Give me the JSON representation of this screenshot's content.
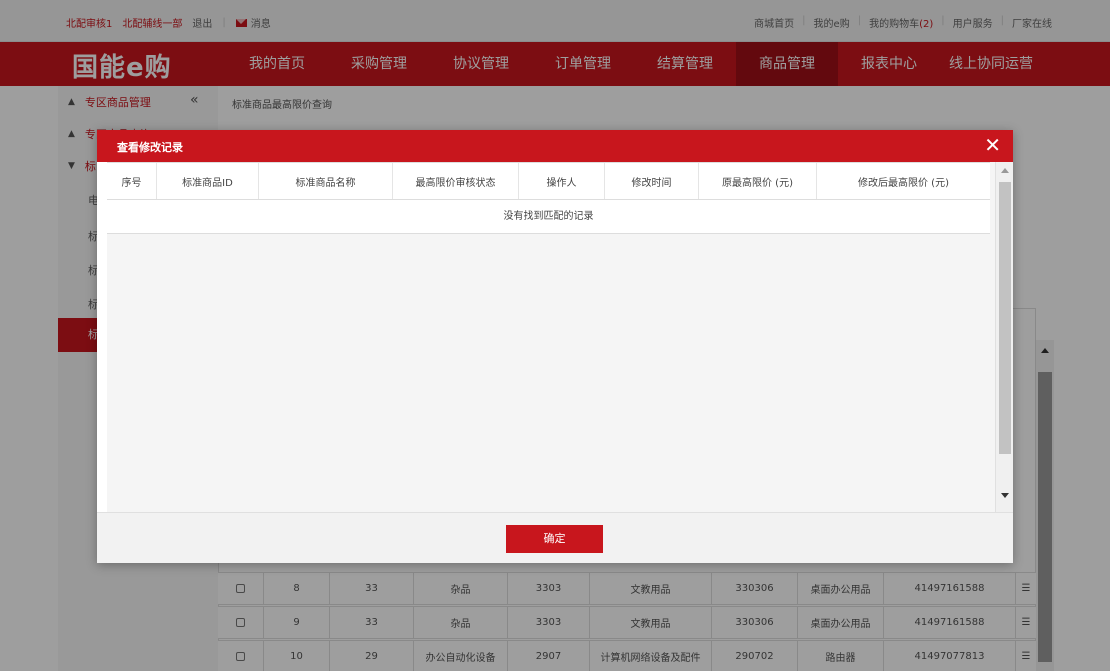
{
  "topbar": {
    "user": "北配审核1",
    "dept": "北配辅线一部",
    "logout": "退出",
    "message": "消息",
    "links": [
      "商城首页",
      "我的e购"
    ],
    "cart_label": "我的购物车",
    "cart_count": "(2)",
    "user_service": "用户服务",
    "vendor_online": "厂家在线"
  },
  "nav": {
    "logo": "国能e购",
    "items": [
      "我的首页",
      "采购管理",
      "协议管理",
      "订单管理",
      "结算管理",
      "商品管理",
      "报表中心",
      "线上协同运营"
    ],
    "active": "商品管理"
  },
  "sidebar": {
    "section1": "专区商品管理",
    "section2": "专区商品查询",
    "section3": "标",
    "subs": [
      "电",
      "标",
      "标",
      "标"
    ],
    "active": "标"
  },
  "breadcrumb": "标准商品最高限价查询",
  "bg_table": {
    "rows": [
      {
        "no": "8",
        "c2": "33",
        "c3": "杂品",
        "c4": "3303",
        "c5": "文教用品",
        "c6": "330306",
        "c7": "桌面办公用品",
        "c8": "41497161588"
      },
      {
        "no": "9",
        "c2": "33",
        "c3": "杂品",
        "c4": "3303",
        "c5": "文教用品",
        "c6": "330306",
        "c7": "桌面办公用品",
        "c8": "41497161588"
      },
      {
        "no": "10",
        "c2": "29",
        "c3": "办公自动化设备",
        "c4": "2907",
        "c5": "计算机网络设备及配件",
        "c6": "290702",
        "c7": "路由器",
        "c8": "41497077813"
      }
    ]
  },
  "modal": {
    "title": "查看修改记录",
    "close": "✕",
    "columns": [
      "序号",
      "标准商品ID",
      "标准商品名称",
      "最高限价审核状态",
      "操作人",
      "修改时间",
      "原最高限价 (元)",
      "修改后最高限价 (元)"
    ],
    "empty_text": "没有找到匹配的记录",
    "ok_label": "确定"
  }
}
